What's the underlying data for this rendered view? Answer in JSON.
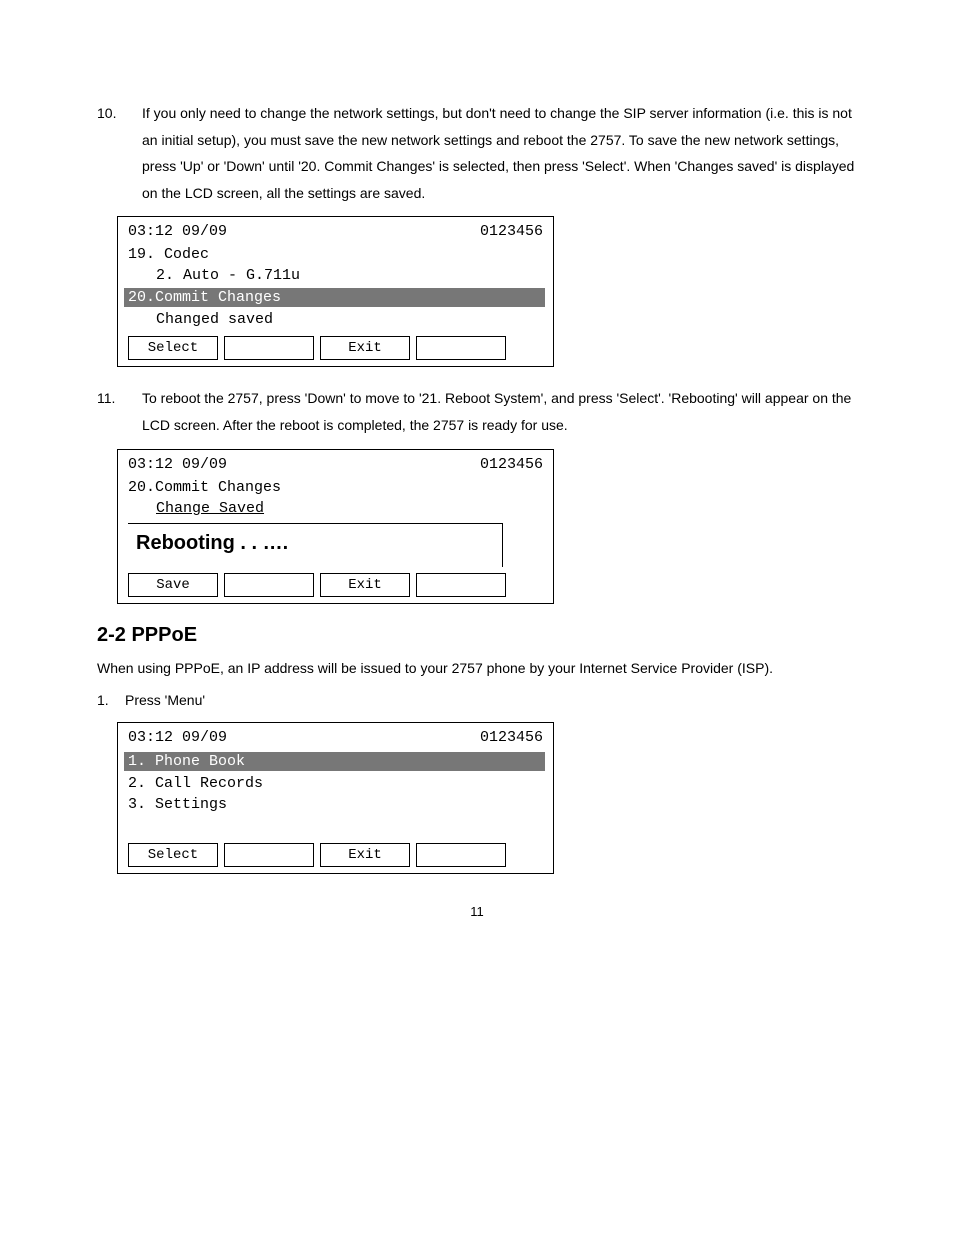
{
  "steps": {
    "step10": {
      "num": "10.",
      "text": "If you only need to change the network settings, but don't need to change the SIP server information (i.e. this is not an initial setup), you must save the new network settings and reboot the 2757. To save the new network settings, press 'Up' or 'Down' until '20. Commit Changes' is selected, then press 'Select'. When 'Changes saved' is displayed on the LCD screen, all the settings are saved."
    },
    "step11": {
      "num": "11.",
      "text": "To reboot the 2757, press 'Down' to move to '21. Reboot System', and press 'Select'. 'Rebooting' will appear on the LCD screen.   After the reboot is completed, the 2757 is ready for use."
    }
  },
  "lcd1": {
    "time": "03:12 09/09",
    "id": "0123456",
    "line1": "19. Codec",
    "line2": "2. Auto - G.711u",
    "highlight": "20.Commit Changes",
    "line3": "Changed saved",
    "sk1": "Select",
    "sk2": "",
    "sk3": "Exit",
    "sk4": ""
  },
  "lcd2": {
    "time": "03:12 09/09",
    "id": "0123456",
    "line1": "20.Commit Changes",
    "line2": "Change Saved",
    "rebooting": "Rebooting . . ….",
    "sk1": "Save",
    "sk2": "",
    "sk3": "Exit",
    "sk4": ""
  },
  "section": {
    "heading": "2-2 PPPoE",
    "body": "When using PPPoE, an IP address will be issued to your 2757 phone by your Internet Service Provider (ISP).",
    "step1num": "1.",
    "step1text": "Press 'Menu'"
  },
  "lcd3": {
    "time": "03:12 09/09",
    "id": "0123456",
    "highlight": "1. Phone Book",
    "line2": "2. Call Records",
    "line3": "3. Settings",
    "sk1": "Select",
    "sk2": "",
    "sk3": "Exit",
    "sk4": ""
  },
  "pageNumber": "11"
}
